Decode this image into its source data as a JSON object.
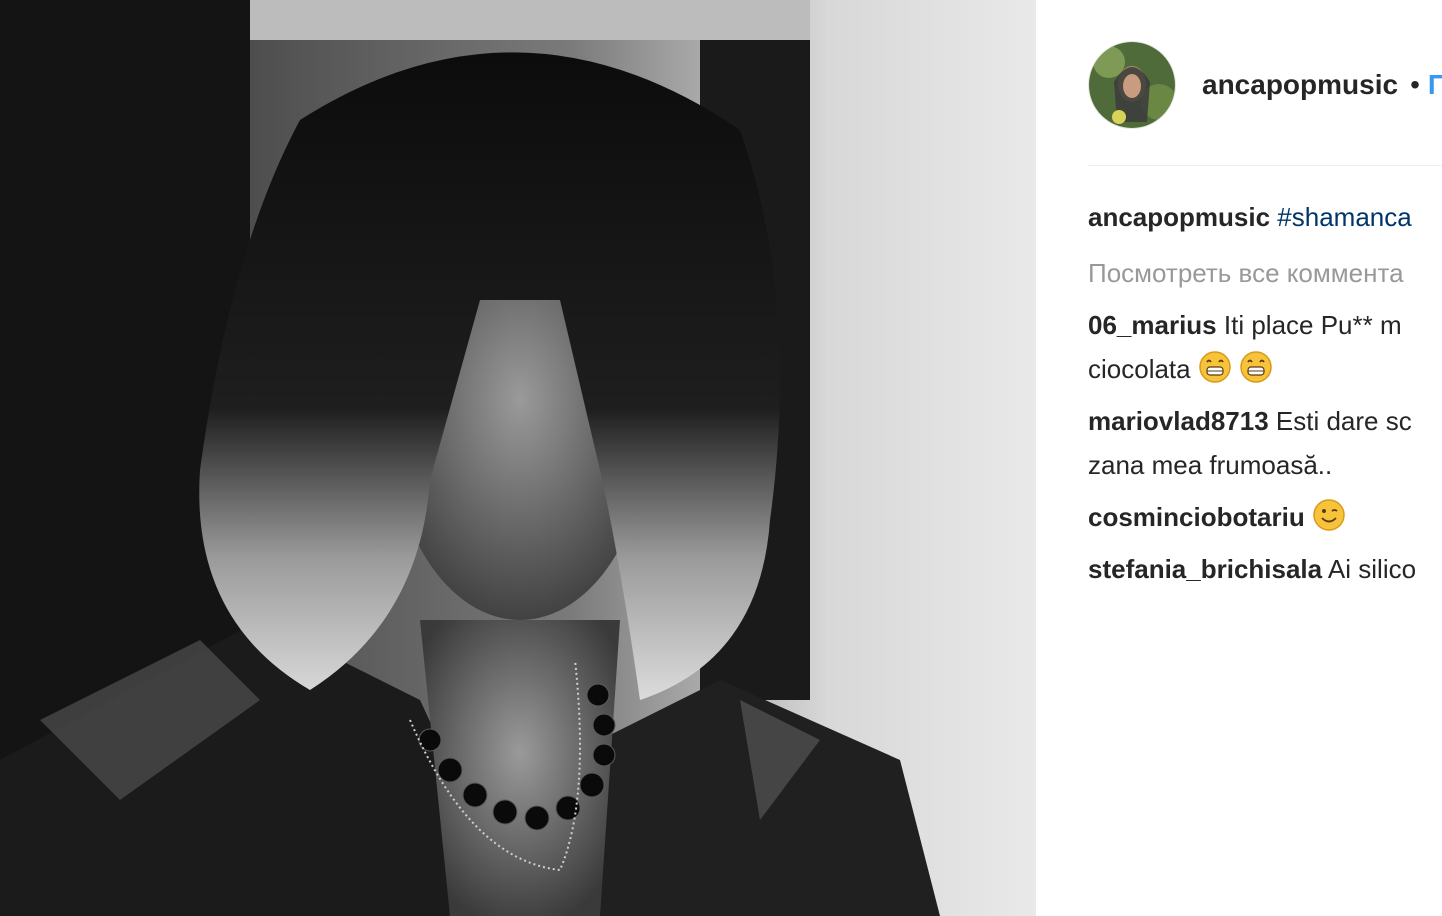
{
  "post": {
    "username": "ancapopmusic",
    "separator": "•",
    "follow_label": "П"
  },
  "caption": {
    "user": "ancapopmusic",
    "text": "#shamanca"
  },
  "view_all_comments": "Посмотреть все коммента",
  "comments": [
    {
      "user": "06_marius",
      "text": "Iti place Pu** m",
      "continuation": "ciocolata",
      "emoji": [
        "grinning-face-icon",
        "grinning-face-icon"
      ]
    },
    {
      "user": "mariovlad8713",
      "text": "Esti dare sc",
      "continuation": "zana mea frumoasă..",
      "emoji": []
    },
    {
      "user": "cosminciobotariu",
      "text": "",
      "continuation": "",
      "emoji": [
        "winking-face-icon"
      ]
    },
    {
      "user": "stefania_brichisala",
      "text": "Ai silico",
      "continuation": "",
      "emoji": []
    }
  ],
  "colors": {
    "link_blue": "#3897f0",
    "hashtag": "#003569",
    "muted": "#999999",
    "text": "#262626"
  }
}
